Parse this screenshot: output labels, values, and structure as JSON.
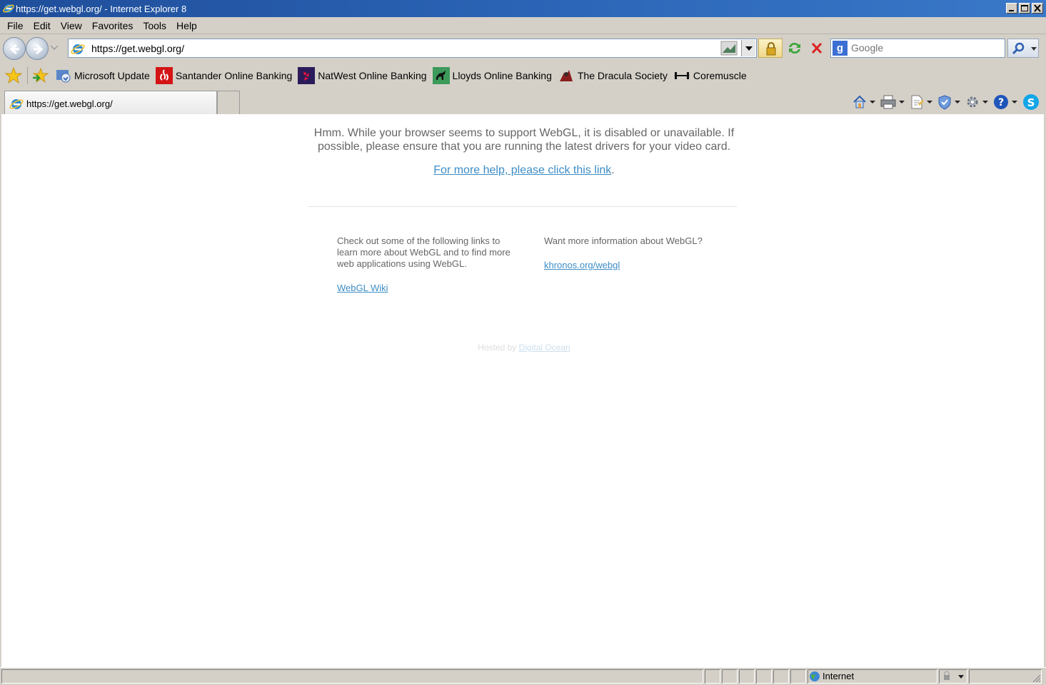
{
  "window": {
    "title": "https://get.webgl.org/ - Internet Explorer 8"
  },
  "menu": [
    "File",
    "Edit",
    "View",
    "Favorites",
    "Tools",
    "Help"
  ],
  "address_bar": {
    "url": "https://get.webgl.org/"
  },
  "search": {
    "placeholder": "Google"
  },
  "favorites": [
    {
      "label": "Microsoft Update",
      "icon": "microsoft-update-icon"
    },
    {
      "label": "Santander Online Banking",
      "icon": "santander-icon"
    },
    {
      "label": "NatWest Online Banking",
      "icon": "natwest-icon"
    },
    {
      "label": "Lloyds Online Banking",
      "icon": "lloyds-icon"
    },
    {
      "label": "The Dracula Society",
      "icon": "dracula-society-icon"
    },
    {
      "label": "Coremuscle",
      "icon": "coremuscle-icon"
    }
  ],
  "tab": {
    "title": "https://get.webgl.org/"
  },
  "page": {
    "lead": "Hmm. While your browser seems to support WebGL, it is disabled or unavailable. If possible, please ensure that you are running the latest drivers for your video card.",
    "help_link": "For more help, please click this link",
    "help_suffix": ".",
    "left_col_text": "Check out some of the following links to learn more about WebGL and to find more web applications using WebGL.",
    "left_col_link": "WebGL Wiki",
    "right_col_text": "Want more information about WebGL?",
    "right_col_link": "khronos.org/webgl",
    "hosted_prefix": "Hosted by ",
    "hosted_link": "Digital Ocean"
  },
  "status": {
    "zone": "Internet"
  },
  "colors": {
    "link": "#3d8dc6",
    "title_bar": "#2c66b8",
    "body_text": "#666666"
  }
}
